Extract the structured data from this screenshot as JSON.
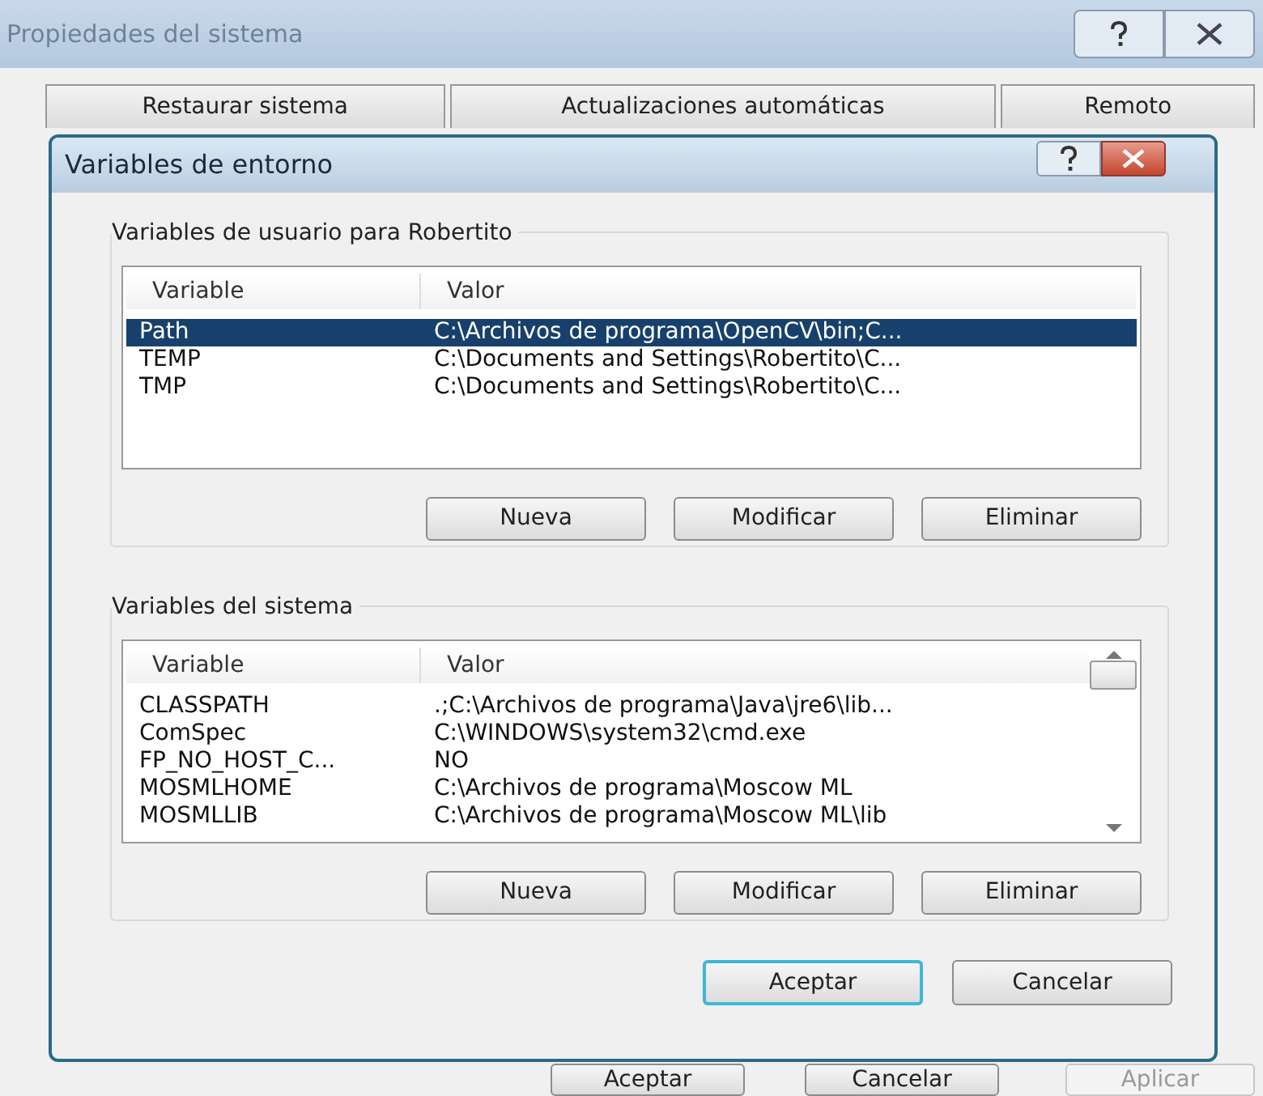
{
  "window": {
    "title": "Propiedades del sistema",
    "tabs": [
      {
        "label": "Restaurar sistema",
        "selected": false
      },
      {
        "label": "Actualizaciones automáticas",
        "selected": false
      },
      {
        "label": "Remoto",
        "selected": false
      }
    ],
    "buttons": [
      {
        "label": "Aceptar",
        "disabled": false
      },
      {
        "label": "Cancelar",
        "disabled": false
      },
      {
        "label": "Aplicar",
        "disabled": true
      }
    ]
  },
  "dialog": {
    "title": "Variables de entorno",
    "groups": [
      {
        "title": "Variables de usuario para Robertito",
        "columns": [
          "Variable",
          "Valor"
        ],
        "scrollbar": false,
        "rows": [
          {
            "variable": "Path",
            "value": "C:\\Archivos de programa\\OpenCV\\bin;C...",
            "selected": true
          },
          {
            "variable": "TEMP",
            "value": "C:\\Documents and Settings\\Robertito\\C...",
            "selected": false
          },
          {
            "variable": "TMP",
            "value": "C:\\Documents and Settings\\Robertito\\C...",
            "selected": false
          }
        ],
        "buttons": [
          "Nueva",
          "Modificar",
          "Eliminar"
        ]
      },
      {
        "title": "Variables del sistema",
        "columns": [
          "Variable",
          "Valor"
        ],
        "scrollbar": true,
        "rows": [
          {
            "variable": "CLASSPATH",
            "value": ".;C:\\Archivos de programa\\Java\\jre6\\lib...",
            "selected": false
          },
          {
            "variable": "ComSpec",
            "value": "C:\\WINDOWS\\system32\\cmd.exe",
            "selected": false
          },
          {
            "variable": "FP_NO_HOST_C...",
            "value": "NO",
            "selected": false
          },
          {
            "variable": "MOSMLHOME",
            "value": "C:\\Archivos de programa\\Moscow ML",
            "selected": false
          },
          {
            "variable": "MOSMLLIB",
            "value": "C:\\Archivos de programa\\Moscow ML\\lib",
            "selected": false
          }
        ],
        "buttons": [
          "Nueva",
          "Modificar",
          "Eliminar"
        ]
      }
    ],
    "buttons": [
      {
        "label": "Aceptar",
        "default": true
      },
      {
        "label": "Cancelar",
        "default": false
      }
    ]
  }
}
